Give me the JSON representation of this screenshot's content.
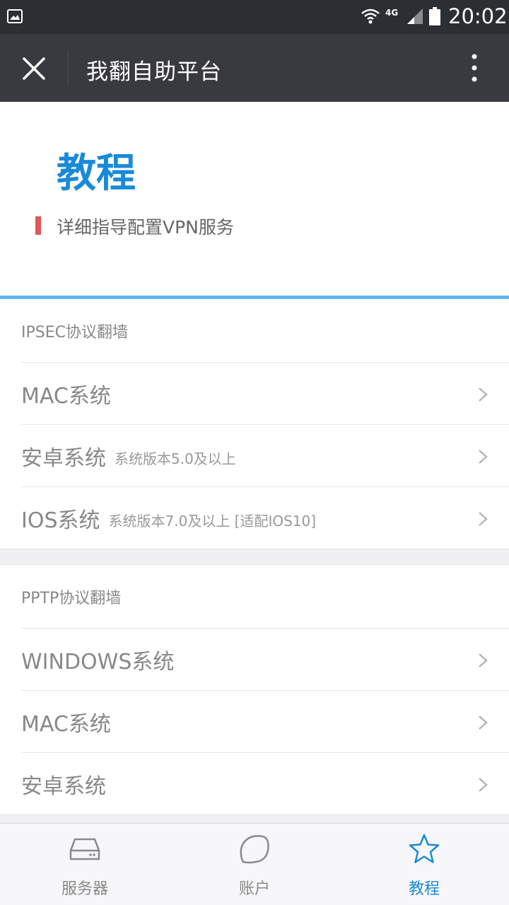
{
  "status_bar": {
    "network": "4G",
    "time": "20:02"
  },
  "app_bar": {
    "title": "我翻自助平台"
  },
  "hero": {
    "title": "教程",
    "subtitle": "详细指导配置VPN服务"
  },
  "sections": [
    {
      "header": "IPSEC协议翻墙",
      "items": [
        {
          "label": "MAC系统",
          "note": ""
        },
        {
          "label": "安卓系统",
          "note": "系统版本5.0及以上"
        },
        {
          "label": "IOS系统",
          "note": "系统版本7.0及以上 [适配IOS10]"
        }
      ]
    },
    {
      "header": "PPTP协议翻墙",
      "items": [
        {
          "label": "WINDOWS系统",
          "note": ""
        },
        {
          "label": "MAC系统",
          "note": ""
        },
        {
          "label": "安卓系统",
          "note": ""
        }
      ]
    }
  ],
  "tab_bar": {
    "tabs": [
      {
        "label": "服务器",
        "icon": "server-icon",
        "active": false
      },
      {
        "label": "账户",
        "icon": "account-icon",
        "active": false
      },
      {
        "label": "教程",
        "icon": "star-icon",
        "active": true
      }
    ]
  },
  "colors": {
    "accent": "#1a8ad8",
    "hero_border": "#64b5f6",
    "marker": "#e05555",
    "app_bar": "#393a3f",
    "status_bar": "#2b2e32"
  }
}
